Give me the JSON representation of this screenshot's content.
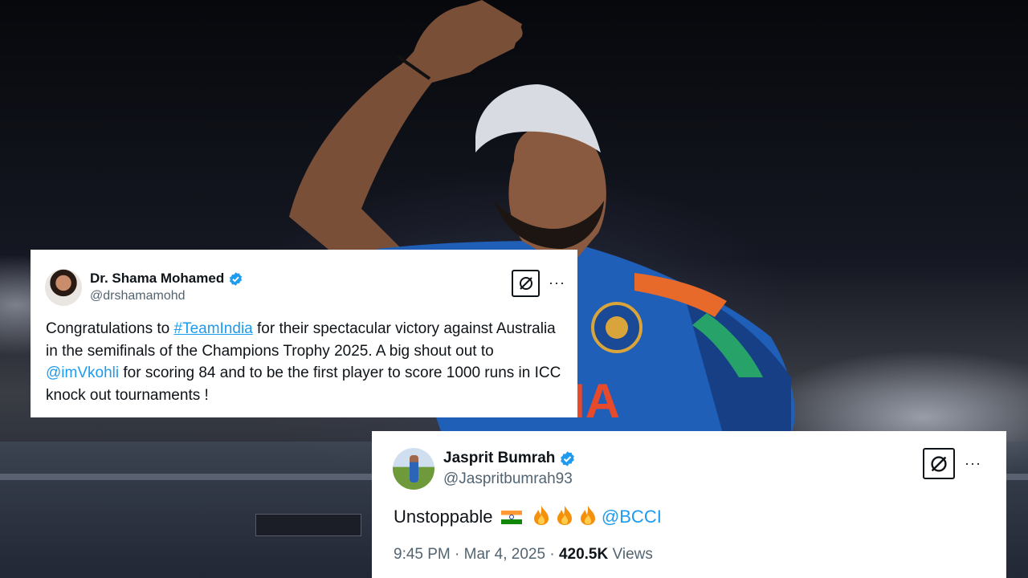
{
  "tweet1": {
    "name": "Dr. Shama Mohamed",
    "handle": "@drshamamohd",
    "text_pre": "Congratulations to ",
    "hashtag": "#TeamIndia",
    "text_mid": " for their spectacular victory against Australia in the semifinals of the Champions Trophy 2025. A big shout out to ",
    "mention": "@imVkohli",
    "text_post": " for scoring 84 and to be the first player to score 1000 runs in ICC knock out tournaments !",
    "more_label": "···",
    "icons": {
      "verified": "verified-badge-icon",
      "grok": "grok-icon",
      "more": "more-options-icon"
    }
  },
  "tweet2": {
    "name": "Jasprit Bumrah",
    "handle": "@Jaspritbumrah93",
    "text": "Unstoppable",
    "mention": "@BCCI",
    "time": "9:45 PM",
    "date": "Mar 4, 2025",
    "separator": "·",
    "views_count": "420.5K",
    "views_label": "Views",
    "more_label": "···",
    "icons": {
      "flag": "india-flag-icon",
      "fire": "fire-icon",
      "verified": "verified-badge-icon",
      "grok": "grok-icon",
      "more": "more-options-icon"
    }
  },
  "colors": {
    "link": "#1d9bf0",
    "verified": "#1d9bf0",
    "text": "#0f1419",
    "muted": "#536471",
    "jersey": "#1f5fb8"
  }
}
